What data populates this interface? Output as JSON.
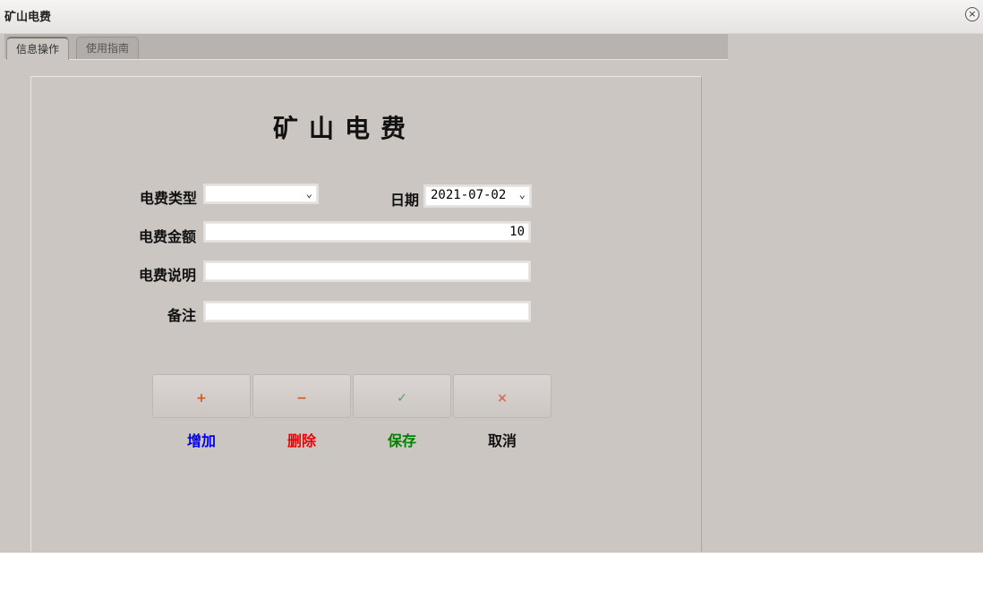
{
  "window": {
    "title": "矿山电费",
    "close_glyph": "×"
  },
  "tabs": [
    {
      "label": "信息操作",
      "active": true
    },
    {
      "label": "使用指南",
      "active": false
    }
  ],
  "form": {
    "title": "矿山电费",
    "fee_type": {
      "label": "电费类型",
      "value": "",
      "chevron": "⌄"
    },
    "date": {
      "label": "日期",
      "value": "2021-07-02",
      "chevron": "⌄"
    },
    "amount": {
      "label": "电费金额",
      "value": "10"
    },
    "description": {
      "label": "电费说明",
      "value": ""
    },
    "remark": {
      "label": "备注",
      "value": ""
    }
  },
  "buttons": {
    "add": {
      "icon": "+",
      "label": "增加",
      "color": "#0000ee",
      "icon_color": "#d9531e"
    },
    "delete": {
      "icon": "−",
      "label": "删除",
      "color": "#ee0000",
      "icon_color": "#d9531e"
    },
    "save": {
      "icon": "✓",
      "label": "保存",
      "color": "#008000",
      "icon_color": "#5a9a6a"
    },
    "cancel": {
      "icon": "×",
      "label": "取消",
      "color": "#111111",
      "icon_color": "#d46a5a"
    }
  }
}
